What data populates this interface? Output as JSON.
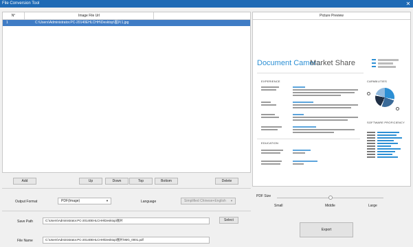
{
  "window": {
    "title": "File Conversion Tool",
    "close": "✕"
  },
  "list": {
    "col_no": "N°",
    "col_url": "Image File Url",
    "rows": [
      {
        "no": "1",
        "url": "C:\\Users\\Administrator.PC-20140EHLCHH\\Desktop\\图片1.jpg"
      }
    ]
  },
  "preview": {
    "header": "Picture Preview",
    "doc_title_left": "Document Camera",
    "doc_title_right": "Market Share",
    "section1": "EXPERIENCE",
    "section2": "EDUCATION",
    "side_title1": "CAPABILITIES",
    "side_title2": "SOFTWARE PROFICIENCY"
  },
  "buttons": {
    "add": "Add",
    "up": "Up",
    "down": "Down",
    "top": "Top",
    "bottom": "Bottom",
    "delete": "Delete",
    "select": "Select",
    "export": "Export"
  },
  "output": {
    "format_label": "Output Format",
    "format_value": "PDF(Image)",
    "language_label": "Language",
    "language_value": "Simplified Chinese+English"
  },
  "pdf_size": {
    "label": "PDF Size",
    "small": "Small",
    "middle": "Middle",
    "large": "Large",
    "level": 0.5
  },
  "paths": {
    "save_label": "Save Path",
    "save_value": "C:\\Users\\Administrator.PC-20140EHLCHH\\Desktop\\图片",
    "name_label": "File Name",
    "name_value": "C:\\Users\\Administrator.PC-20140EHLCHH\\Desktop\\图片\\IMG_0001.pdf"
  }
}
